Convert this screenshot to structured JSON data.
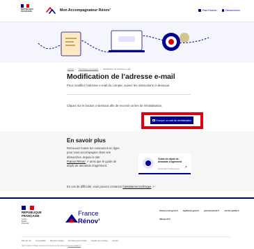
{
  "header": {
    "gov_line1": "RÉPUBLIQUE",
    "gov_line2": "FRANÇAISE",
    "app_title": "Mon Accompagnateur Rénov'",
    "actions": [
      {
        "label": "Paul Hochon",
        "icon": "user-icon"
      },
      {
        "label": "Déconnexion",
        "icon": "logout-icon"
      }
    ]
  },
  "breadcrumb": [
    {
      "label": "Accueil"
    },
    {
      "label": "Paramètres du compte"
    },
    {
      "label": "Modification de l'adresse e-mail"
    }
  ],
  "main": {
    "title": "Modification de l’adresse e-mail",
    "description": "Pour modifier l’adresse e-mail du compte, suivez les instructions ci-dessous.",
    "instruction": "Cliquez sur le bouton ci-dessous afin de recevoir un lien de réinitialisation.",
    "send_button": "Envoyer un mail de réinitialisation"
  },
  "more": {
    "title": "En savoir plus",
    "text_lines": [
      "Retrouvez toutes les ressources en ligne",
      "pour vous accompagner dans vos",
      "démarches, depuis le site"
    ],
    "link_france_renov": "France Rénov’",
    "text_after_link": " ainsi que le guide de",
    "text_last": "dépôt de demande d’agrément.",
    "help_text": "En cas de difficulté, vous pouvez contacter ",
    "help_link": "l’assistance technique",
    "guide": {
      "title": "Guide de dépôt de demande d’agrément",
      "subtitle": "France Rénov’ Professionnel"
    }
  },
  "footer": {
    "gov_line1": "RÉPUBLIQUE",
    "gov_line2": "FRANÇAISE",
    "motto": [
      "Liberté",
      "Égalité",
      "Fraternité"
    ],
    "brand_line1": "France",
    "brand_line2": "Rénov’",
    "links": [
      "france-renov.gouv.fr",
      "legifrance.gouv.fr",
      "gouvernement.fr",
      "service-public.fr",
      "data.gouv.fr"
    ],
    "bottom_links": [
      "Plan du site",
      "Accessibilité",
      "Mentions légales",
      "Données personnelles",
      "Gestion des cookies",
      "Contact"
    ],
    "license_text": "Sauf mention contraire, tous les contenus de ce site sont sous ",
    "license_link": "licence etalab-2.0"
  },
  "colors": {
    "accent": "#000091",
    "highlight": "#e1000f",
    "hero_bg": "#f5f5fe",
    "more_bg": "#f6f6f6"
  }
}
